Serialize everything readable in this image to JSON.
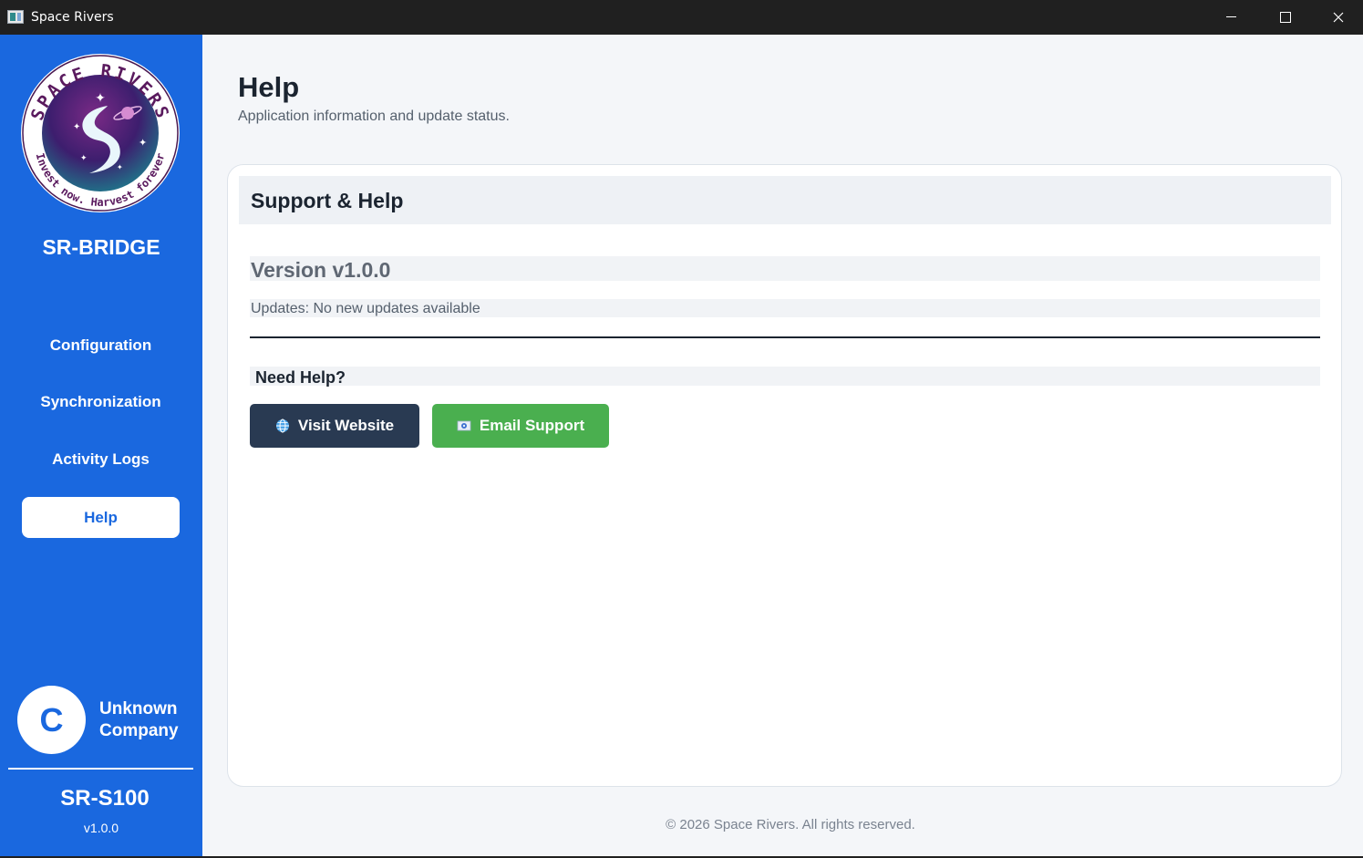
{
  "window": {
    "title": "Space Rivers",
    "icon": "app-window-icon"
  },
  "sidebar": {
    "logo": {
      "ring_text": "SPACE RIVERS",
      "tagline": "Invest now. Harvest forever"
    },
    "brand": "SR-BRIDGE",
    "nav": [
      {
        "label": "Configuration",
        "active": false
      },
      {
        "label": "Synchronization",
        "active": false
      },
      {
        "label": "Activity Logs",
        "active": false
      },
      {
        "label": "Help",
        "active": true
      }
    ],
    "user": {
      "initial": "C",
      "company": "Unknown Company"
    },
    "model": "SR-S100",
    "version": "v1.0.0"
  },
  "main": {
    "title": "Help",
    "subtitle": "Application information and update status.",
    "card": {
      "title": "Support & Help",
      "version": "Version v1.0.0",
      "updates": "Updates: No new updates available",
      "help_heading": "Need Help?",
      "buttons": {
        "website": {
          "label": "Visit Website",
          "icon": "globe-icon"
        },
        "email": {
          "label": "Email Support",
          "icon": "mail-icon"
        }
      }
    },
    "footer": "© 2026 Space Rivers. All rights reserved."
  },
  "colors": {
    "sidebar": "#1a68df",
    "title_bar": "#202020",
    "main_bg": "#f4f6f9",
    "website_button": "#293a52",
    "email_button": "#4aaf4f"
  }
}
